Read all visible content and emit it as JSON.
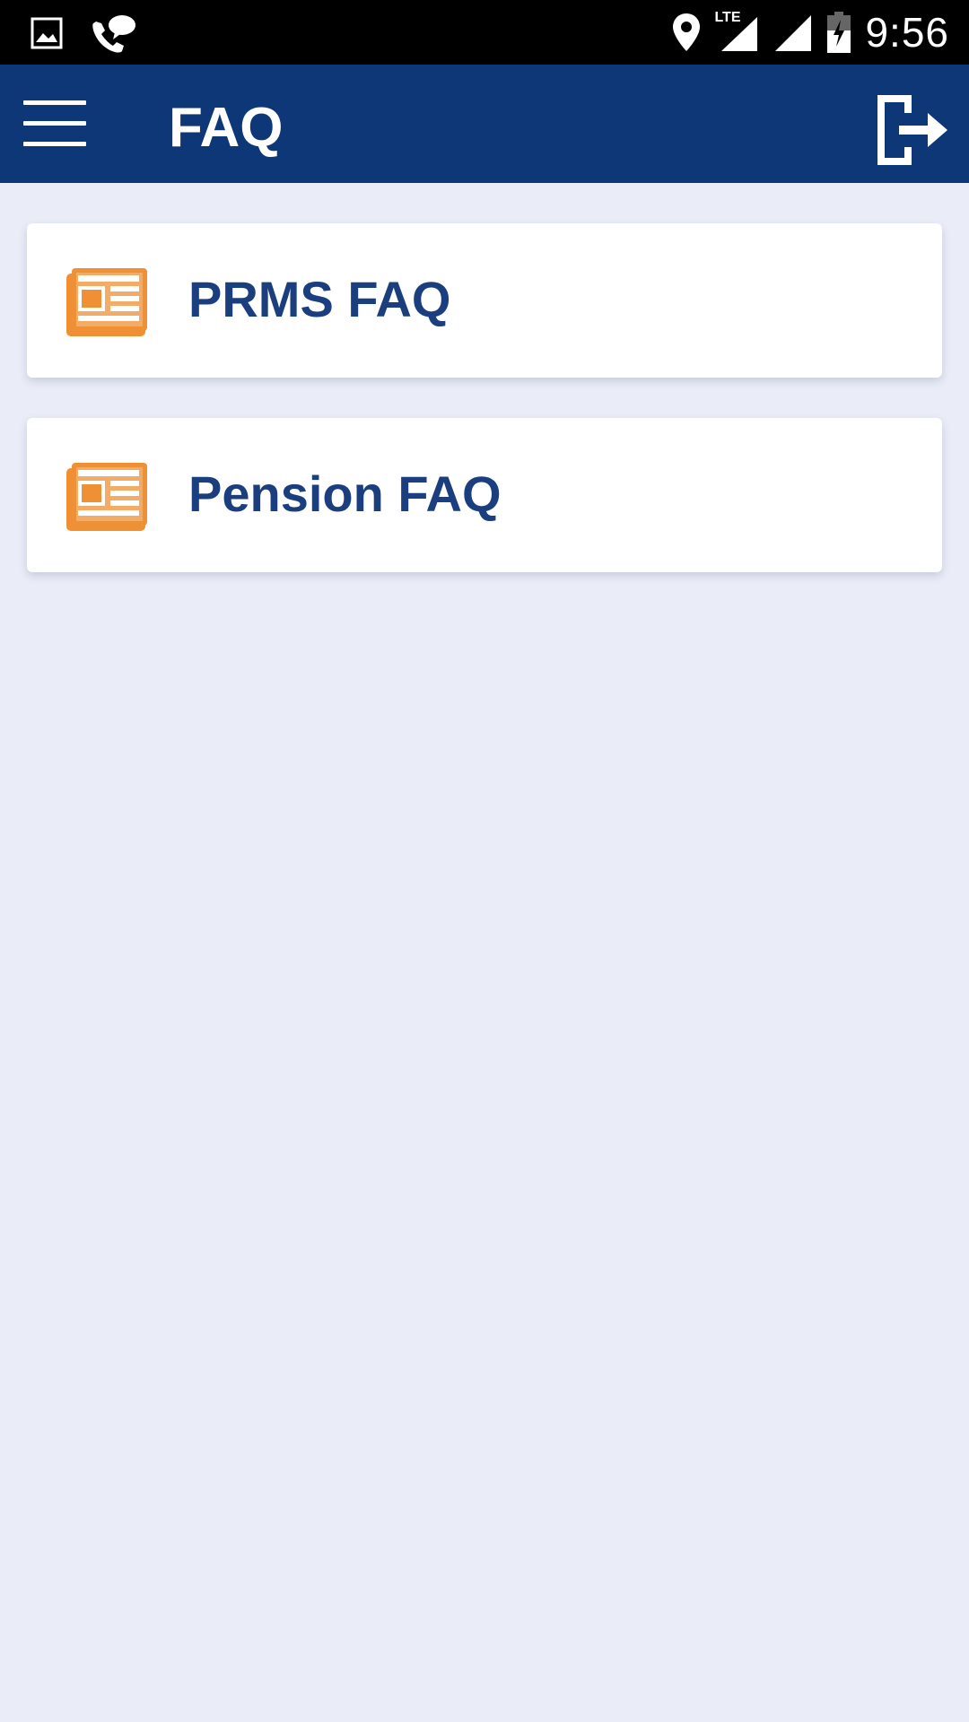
{
  "status_bar": {
    "time": "9:56",
    "network_label": "LTE",
    "icons": [
      "gallery-icon",
      "phone-chat-icon",
      "location-icon",
      "lte-signal-icon",
      "signal-icon",
      "battery-charging-icon"
    ]
  },
  "app_bar": {
    "title": "FAQ",
    "menu_icon": "hamburger-menu-icon",
    "logout_icon": "logout-icon",
    "background_color": "#0e3778"
  },
  "faq_list": {
    "items": [
      {
        "label": "PRMS FAQ",
        "icon": "document-icon"
      },
      {
        "label": "Pension FAQ",
        "icon": "document-icon"
      }
    ]
  },
  "colors": {
    "accent_orange": "#ef9035",
    "label_blue": "#1b3f7e",
    "page_background": "#eaedf8"
  }
}
